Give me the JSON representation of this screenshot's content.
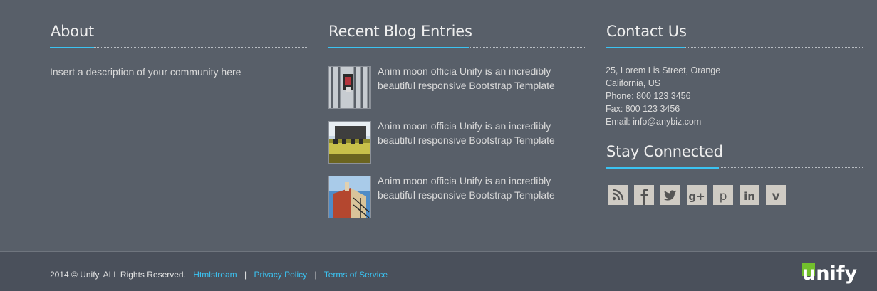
{
  "about": {
    "title": "About",
    "text": "Insert a description of your community here"
  },
  "blog": {
    "title": "Recent Blog Entries",
    "posts": [
      {
        "line1": "Anim moon officia Unify is an incredibly",
        "line2": "beautiful responsive Bootstrap Template"
      },
      {
        "line1": "Anim moon officia Unify is an incredibly",
        "line2": "beautiful responsive Bootstrap Template"
      },
      {
        "line1": "Anim moon officia Unify is an incredibly",
        "line2": "beautiful responsive Bootstrap Template"
      }
    ]
  },
  "contact": {
    "title": "Contact Us",
    "address1": "25, Lorem Lis Street, Orange",
    "address2": "California, US",
    "phone": "Phone: 800 123 3456",
    "fax": "Fax: 800 123 3456",
    "email": "Email: info@anybiz.com"
  },
  "social": {
    "title": "Stay Connected",
    "icons": [
      "rss-icon",
      "facebook-icon",
      "twitter-icon",
      "google-plus-icon",
      "pinterest-icon",
      "linkedin-icon",
      "vimeo-icon"
    ]
  },
  "footer": {
    "copyright": "2014 © Unify. ALL Rights Reserved.",
    "links": [
      "Htmlstream",
      "Privacy Policy",
      "Terms of Service"
    ],
    "separator": "|",
    "logo_text": "unify"
  },
  "colors": {
    "background": "#585f69",
    "bar": "#4a505b",
    "accent": "#3bc3f2",
    "logo_green": "#72c02c"
  }
}
